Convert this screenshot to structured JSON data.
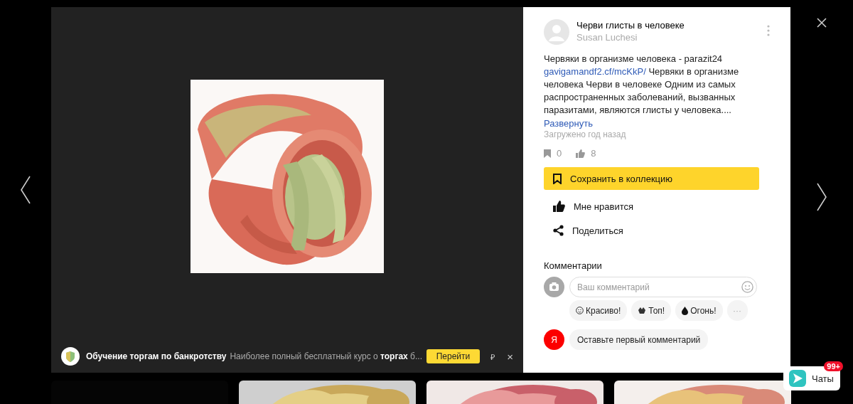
{
  "viewer": {
    "picture": {
      "kind": "picture"
    }
  },
  "post": {
    "title": "Черви глисты в человеке",
    "author": "Susan Luchesi",
    "description_start": "Червяки в организме человека - parazit24",
    "link": "gavigamandf2.cf/mcKkP/",
    "description_end": "Червяки в организме человека Черви в человеке Одним из самых распространенных заболеваний, вызванных паразитами, являются глисты у человека....",
    "expand": "Развернуть",
    "uploaded": "Загружено год назад",
    "collections_count": "0",
    "likes_count": "8"
  },
  "actions": [
    {
      "kind": "save",
      "label": "Сохранить в коллекцию"
    },
    {
      "kind": "like",
      "label": "Мне нравится"
    },
    {
      "kind": "share",
      "label": "Поделиться"
    }
  ],
  "comments": {
    "heading": "Комментарии",
    "placeholder": "Ваш комментарий",
    "reactions": [
      {
        "kind": "smile",
        "label": "Красиво!"
      },
      {
        "kind": "hands",
        "label": "Топ!"
      },
      {
        "kind": "fire",
        "label": "Огонь!"
      }
    ],
    "more": "···",
    "avatar_letter": "Я",
    "prompt": "Оставьте первый комментарий"
  },
  "ad": {
    "title": "Обучение торгам по банкротству",
    "text": "Наиболее полный бесплатный курс о **торгах** б...",
    "button": "Перейти",
    "currency": "₽",
    "close": "×"
  },
  "thumbnails": [
    {
      "kind": "empty"
    },
    {
      "kind": "picture"
    },
    {
      "kind": "picture"
    },
    {
      "kind": "picture"
    }
  ],
  "chats": {
    "label": "Чаты",
    "badge": "99+"
  }
}
